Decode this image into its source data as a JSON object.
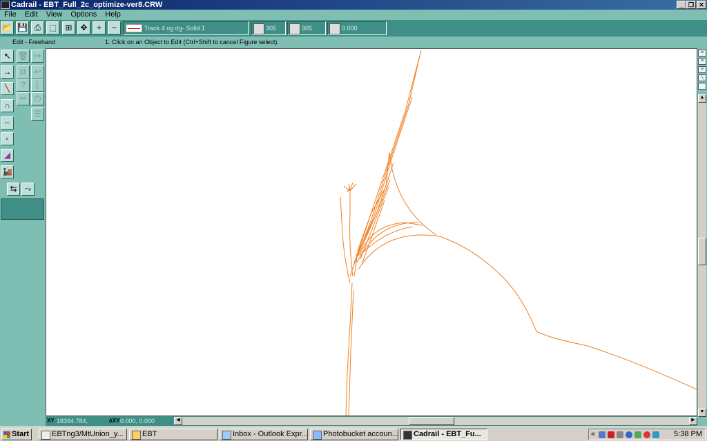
{
  "window": {
    "title": "Cadrail - EBT_Full_2c_optimize-ver8.CRW",
    "minimize_label": "_",
    "restore_label": "❐",
    "close_label": "✕"
  },
  "menu": [
    "File",
    "Edit",
    "View",
    "Options",
    "Help"
  ],
  "toolbar": {
    "track_label": "Track 4 ng dg- Solid 1",
    "grid_value": "305",
    "snap_value": "305",
    "angle_value": "0.000"
  },
  "status": {
    "mode": "Edit - Freehand",
    "instruction": "1. Click on an Object to Edit (Ctrl+Shift to cancel Figure select)."
  },
  "bottom": {
    "xy_readout": "18394.784,",
    "delta_readout": "0.000, 0.000"
  },
  "taskbar": {
    "start_label": "Start",
    "tasks": [
      "EBTng3/MtUnion_y...",
      "EBT",
      "Inbox - Outlook Expr...",
      "Photobucket accoun...",
      "Cadrail - EBT_Fu..."
    ],
    "clock": "5:38 PM",
    "tray_chevron": "«"
  },
  "colors": {
    "track": "#f07f20",
    "app_bg": "#7fbfb3",
    "toolbar": "#3f8f86"
  }
}
